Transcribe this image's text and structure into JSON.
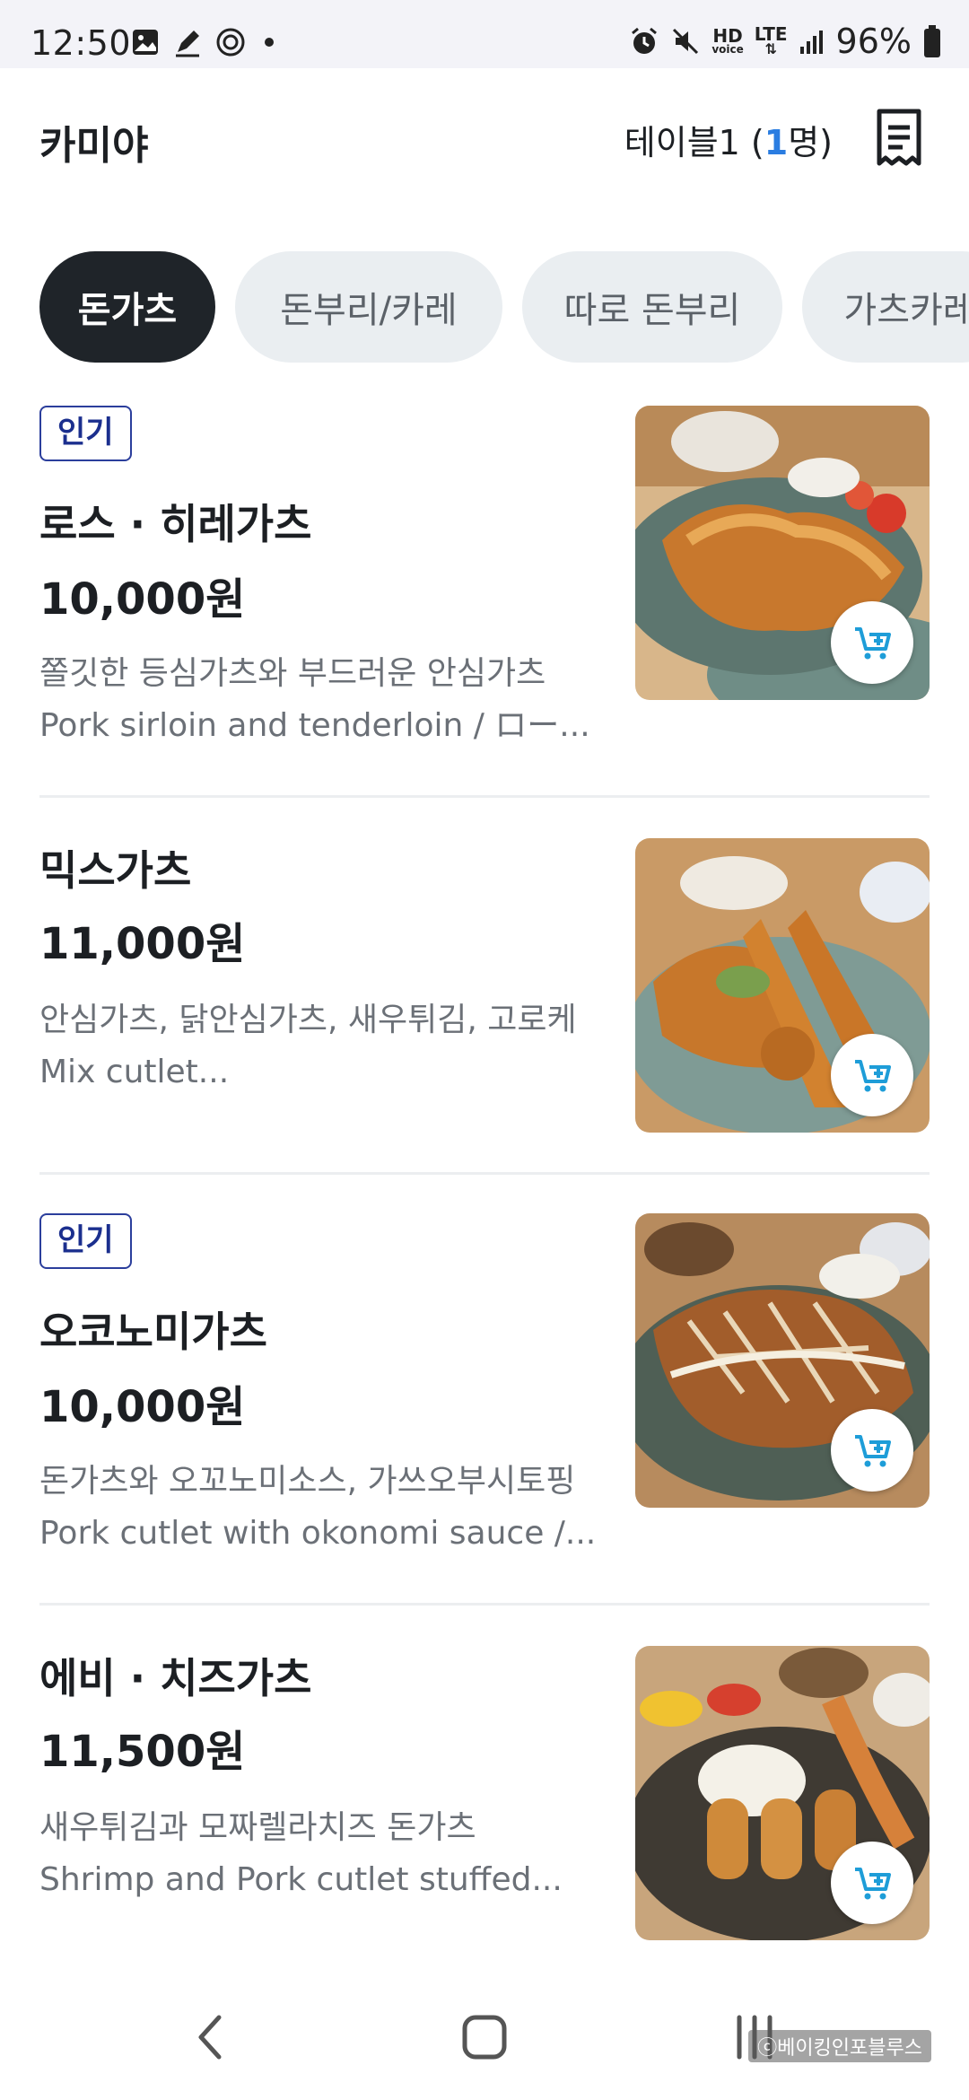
{
  "status_bar": {
    "time": "12:50",
    "battery": "96%",
    "icons": [
      "gallery-icon",
      "pen-icon",
      "app-icon",
      "dot-icon",
      "alarm-icon",
      "mute-icon",
      "hd-voice-icon",
      "lte-icon",
      "signal-icon",
      "battery-icon"
    ],
    "hd_label": "HD",
    "voice_label": "voice",
    "lte_label": "LTE"
  },
  "header": {
    "store_name": "카미야",
    "table_prefix": "테이블1 (",
    "table_count": "1",
    "table_suffix": "명)"
  },
  "tabs": [
    {
      "label": "돈가츠",
      "active": true
    },
    {
      "label": "돈부리/카레",
      "active": false
    },
    {
      "label": "따로 돈부리",
      "active": false
    },
    {
      "label": "가츠카레",
      "active": false
    }
  ],
  "menu": [
    {
      "badge": "인기",
      "name": "로스 · 히레가츠",
      "price": "10,000원",
      "desc_ko": "쫄깃한 등심가츠와 부드러운 안심가츠",
      "desc_en": "Pork sirloin and tenderloin / ロー..."
    },
    {
      "badge": "",
      "name": "믹스가츠",
      "price": "11,000원",
      "desc_ko": "안심가츠, 닭안심가츠, 새우튀김, 고로케",
      "desc_en": "Mix cutlet..."
    },
    {
      "badge": "인기",
      "name": "오코노미가츠",
      "price": "10,000원",
      "desc_ko": "돈가츠와 오꼬노미소스, 가쓰오부시토핑",
      "desc_en": "Pork cutlet with okonomi sauce /..."
    },
    {
      "badge": "",
      "name": "에비 · 치즈가츠",
      "price": "11,500원",
      "desc_ko": "새우튀김과 모짜렐라치즈 돈가츠",
      "desc_en": "Shrimp and Pork cutlet stuffed..."
    }
  ],
  "watermark": "ⓒ베이킹인포블루스",
  "colors": {
    "accent": "#2a7de1",
    "cart": "#1e9dd8",
    "active_tab": "#1f2429",
    "badge": "#1b2f8e"
  }
}
